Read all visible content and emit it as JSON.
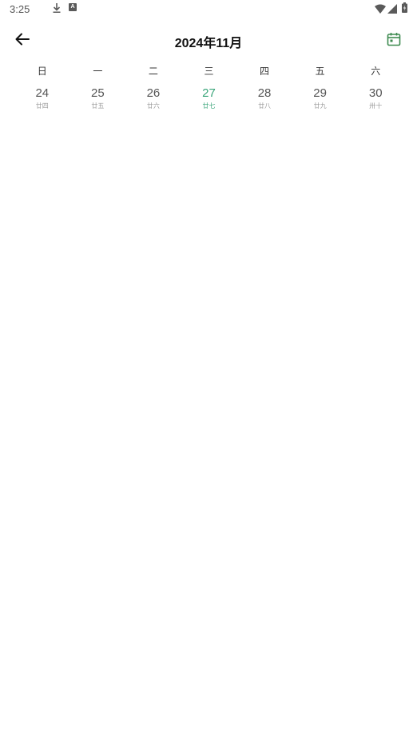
{
  "status_bar": {
    "time": "3:25",
    "icons": [
      "download-icon",
      "a-badge-icon",
      "wifi-icon",
      "signal-icon",
      "battery-icon"
    ],
    "a_badge": "A"
  },
  "header": {
    "title": "2024年11月",
    "back_icon": "arrow-left-icon",
    "calendar_icon": "calendar-icon"
  },
  "colors": {
    "accent": "#3aa57a",
    "calendar_icon": "#3d8a4f",
    "muted": "#9a9a9a"
  },
  "week": {
    "weekday_labels": [
      "日",
      "一",
      "二",
      "三",
      "四",
      "五",
      "六"
    ],
    "days": [
      {
        "number": "24",
        "lunar": "廿四",
        "today": false
      },
      {
        "number": "25",
        "lunar": "廿五",
        "today": false
      },
      {
        "number": "26",
        "lunar": "廿六",
        "today": false
      },
      {
        "number": "27",
        "lunar": "廿七",
        "today": true
      },
      {
        "number": "28",
        "lunar": "廿八",
        "today": false
      },
      {
        "number": "29",
        "lunar": "廿九",
        "today": false
      },
      {
        "number": "30",
        "lunar": "卅十",
        "today": false
      }
    ]
  }
}
